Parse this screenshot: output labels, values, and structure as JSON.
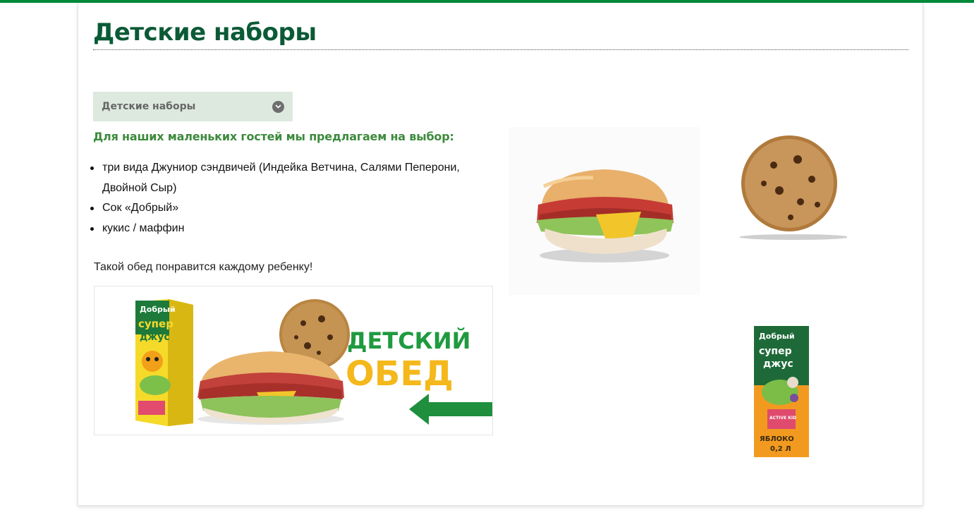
{
  "page": {
    "title": "Детские наборы",
    "accent_color": "#008938",
    "title_color": "#0b5a36"
  },
  "dropdown": {
    "selected": "Детские наборы",
    "icon": "chevron-down-icon"
  },
  "content": {
    "subheading": "Для наших маленьких гостей мы предлагаем на выбор:",
    "items": [
      "три вида Джуниор сэндвичей (Индейка Ветчина, Салями Пеперони, Двойной Сыр)",
      "Сок «Добрый»",
      "кукис / маффин"
    ],
    "note": "Такой обед понравится каждому ребенку!"
  },
  "banner": {
    "line1": "ДЕТСКИЙ",
    "line2": "ОБЕД",
    "juice_brand": "Добрый",
    "juice_name_1": "супер",
    "juice_name_2": "джус"
  },
  "juice_pack": {
    "brand": "Добрый",
    "name_1": "супер",
    "name_2": "джус",
    "badge": "ACTIVE KID",
    "flavor": "ЯБЛОКО",
    "volume": "0,2 Л"
  }
}
